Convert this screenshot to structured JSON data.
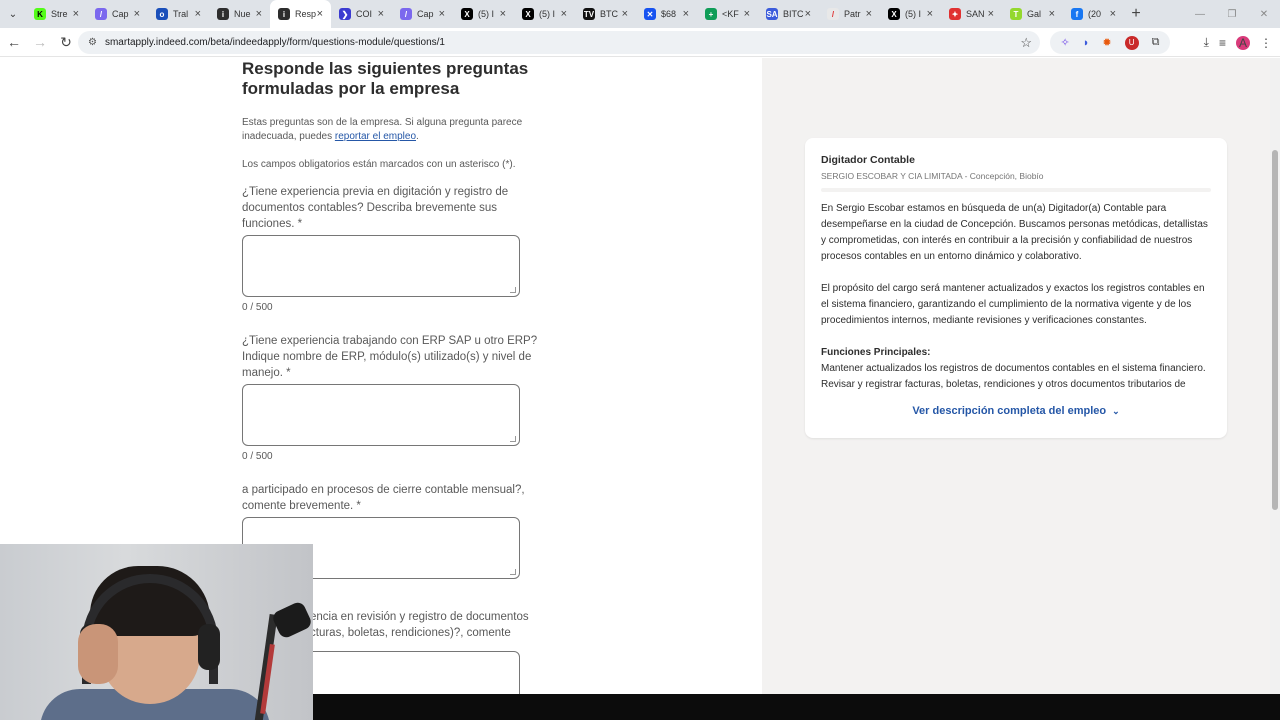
{
  "browser": {
    "tabs": [
      {
        "title": "Stre",
        "icon_color": "#53fc18",
        "icon_glyph": "K",
        "icon_fg": "#000"
      },
      {
        "title": "Cap",
        "icon_color": "#7b68ee",
        "icon_glyph": "/",
        "icon_fg": "#fff"
      },
      {
        "title": "Tral",
        "icon_color": "#1a4fba",
        "icon_glyph": "o",
        "icon_fg": "#fff"
      },
      {
        "title": "Nue",
        "icon_color": "#2d2d2d",
        "icon_glyph": "i",
        "icon_fg": "#fff"
      },
      {
        "title": "Resp",
        "icon_color": "#2d2d2d",
        "icon_glyph": "i",
        "icon_fg": "#fff",
        "active": true
      },
      {
        "title": "COI",
        "icon_color": "#3b3bd1",
        "icon_glyph": "❯",
        "icon_fg": "#fff"
      },
      {
        "title": "Cap",
        "icon_color": "#7b68ee",
        "icon_glyph": "/",
        "icon_fg": "#fff"
      },
      {
        "title": "(5) I",
        "icon_color": "#000",
        "icon_glyph": "X",
        "icon_fg": "#fff"
      },
      {
        "title": "(5) I",
        "icon_color": "#000",
        "icon_glyph": "X",
        "icon_fg": "#fff"
      },
      {
        "title": "BTC",
        "icon_color": "#111",
        "icon_glyph": "TV",
        "icon_fg": "#fff"
      },
      {
        "title": "$68",
        "icon_color": "#1652f0",
        "icon_glyph": "✕",
        "icon_fg": "#fff"
      },
      {
        "title": "<KF",
        "icon_color": "#0f9d58",
        "icon_glyph": "+",
        "icon_fg": "#fff"
      },
      {
        "title": "BITC",
        "icon_color": "#3b5bdb",
        "icon_glyph": "SA",
        "icon_fg": "#fff"
      },
      {
        "title": "Patr",
        "icon_color": "#e8e8e8",
        "icon_glyph": "/",
        "icon_fg": "#e03131"
      },
      {
        "title": "(5) I",
        "icon_color": "#000",
        "icon_glyph": "X",
        "icon_fg": "#fff"
      },
      {
        "title": "SAN",
        "icon_color": "#e03131",
        "icon_glyph": "✦",
        "icon_fg": "#fff"
      },
      {
        "title": "Gal",
        "icon_color": "#94d82d",
        "icon_glyph": "T",
        "icon_fg": "#fff"
      },
      {
        "title": "(20",
        "icon_color": "#1877f2",
        "icon_glyph": "f",
        "icon_fg": "#fff"
      }
    ],
    "url": "smartapply.indeed.com/beta/indeedapply/form/questions-module/questions/1",
    "profile_initial": "A"
  },
  "form": {
    "heading": "Responde las siguientes preguntas formuladas por la empresa",
    "intro_text": "Estas preguntas son de la empresa. Si alguna pregunta parece inadecuada, puedes ",
    "report_link": "reportar el empleo",
    "intro_end": ".",
    "required_note": "Los campos obligatorios están marcados con un asterisco (*).",
    "questions": [
      {
        "label": "¿Tiene experiencia previa en digitación y registro de documentos contables? Describa brevemente sus funciones. *",
        "counter": "0 / 500"
      },
      {
        "label": "¿Tiene experiencia trabajando con ERP SAP u otro ERP? Indique nombre de ERP, módulo(s) utilizado(s) y nivel de manejo. *",
        "counter": "0 / 500"
      },
      {
        "label": "a participado en procesos de cierre contable mensual?, comente brevemente. *",
        "counter": ""
      },
      {
        "label": "encia en revisión y registro de documentos cturas, boletas, rendiciones)?, comente",
        "counter": ""
      }
    ]
  },
  "job": {
    "title": "Digitador Contable",
    "company": "SERGIO ESCOBAR Y CIA LIMITADA - Concepción, Biobío",
    "para1": "En Sergio Escobar estamos en búsqueda de un(a) Digitador(a) Contable para desempeñarse en la ciudad de Concepción. Buscamos personas metódicas, detallistas y comprometidas, con interés en contribuir a la precisión y confiabilidad de nuestros procesos contables en un entorno dinámico y colaborativo.",
    "para2": "El propósito del cargo será mantener actualizados y exactos los registros contables en el sistema financiero, garantizando el cumplimiento de la normativa vigente y de los procedimientos internos, mediante revisiones y verificaciones constantes.",
    "functions_heading": "Funciones Principales:",
    "function1": "Mantener actualizados los registros de documentos contables en el sistema financiero.",
    "function2": "Revisar y registrar facturas, boletas, rendiciones y otros documentos tributarios de manera",
    "more_link": "Ver descripción completa del empleo"
  },
  "colors": {
    "link": "#2557a7",
    "panel_bg": "#f3f2f1",
    "text": "#2d2d2d"
  }
}
